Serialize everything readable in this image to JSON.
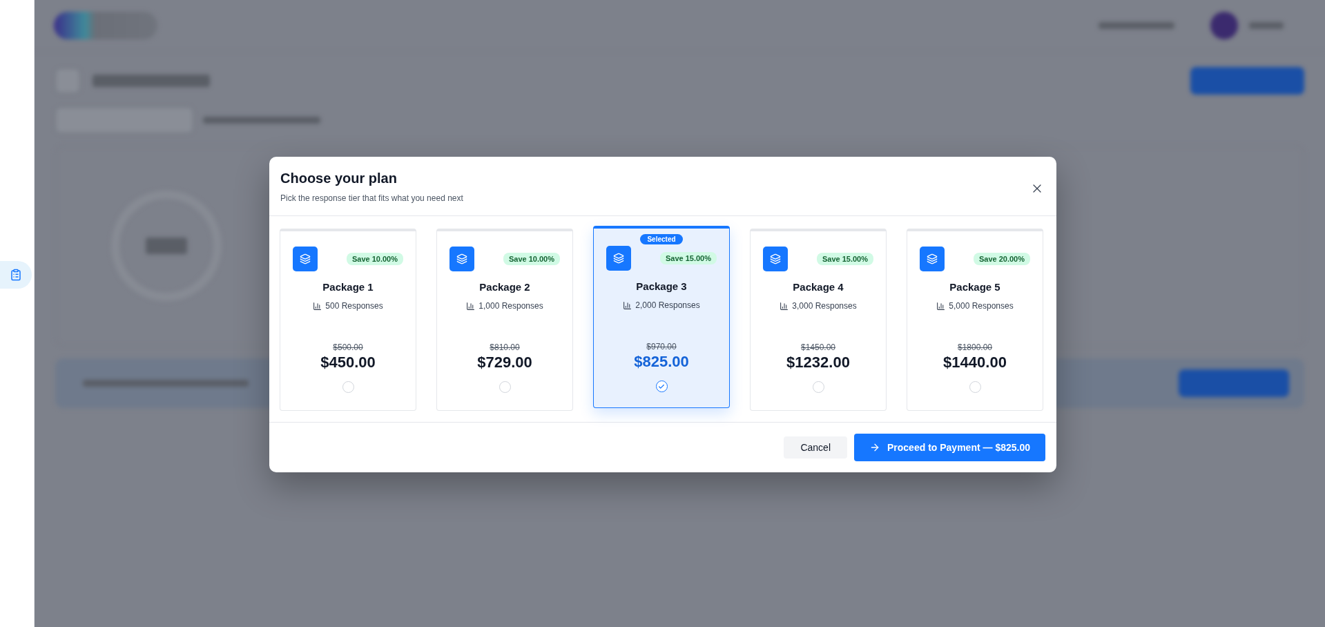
{
  "sidebar": {
    "items": [
      {
        "selected": true
      }
    ]
  },
  "modal": {
    "title": "Choose your plan",
    "subtitle": "Pick the response tier that fits what you need next",
    "selected_badge": "Selected",
    "packages": [
      {
        "name": "Package 1",
        "responses": "500 Responses",
        "save": "Save 10.00%",
        "old_price": "$500.00",
        "price": "$450.00",
        "selected": false
      },
      {
        "name": "Package 2",
        "responses": "1,000 Responses",
        "save": "Save 10.00%",
        "old_price": "$810.00",
        "price": "$729.00",
        "selected": false
      },
      {
        "name": "Package 3",
        "responses": "2,000 Responses",
        "save": "Save 15.00%",
        "old_price": "$970.00",
        "price": "$825.00",
        "selected": true
      },
      {
        "name": "Package 4",
        "responses": "3,000 Responses",
        "save": "Save 15.00%",
        "old_price": "$1450.00",
        "price": "$1232.00",
        "selected": false
      },
      {
        "name": "Package 5",
        "responses": "5,000 Responses",
        "save": "Save 20.00%",
        "old_price": "$1800.00",
        "price": "$1440.00",
        "selected": false
      }
    ],
    "cancel": "Cancel",
    "proceed": "Proceed to Payment — $825.00"
  }
}
